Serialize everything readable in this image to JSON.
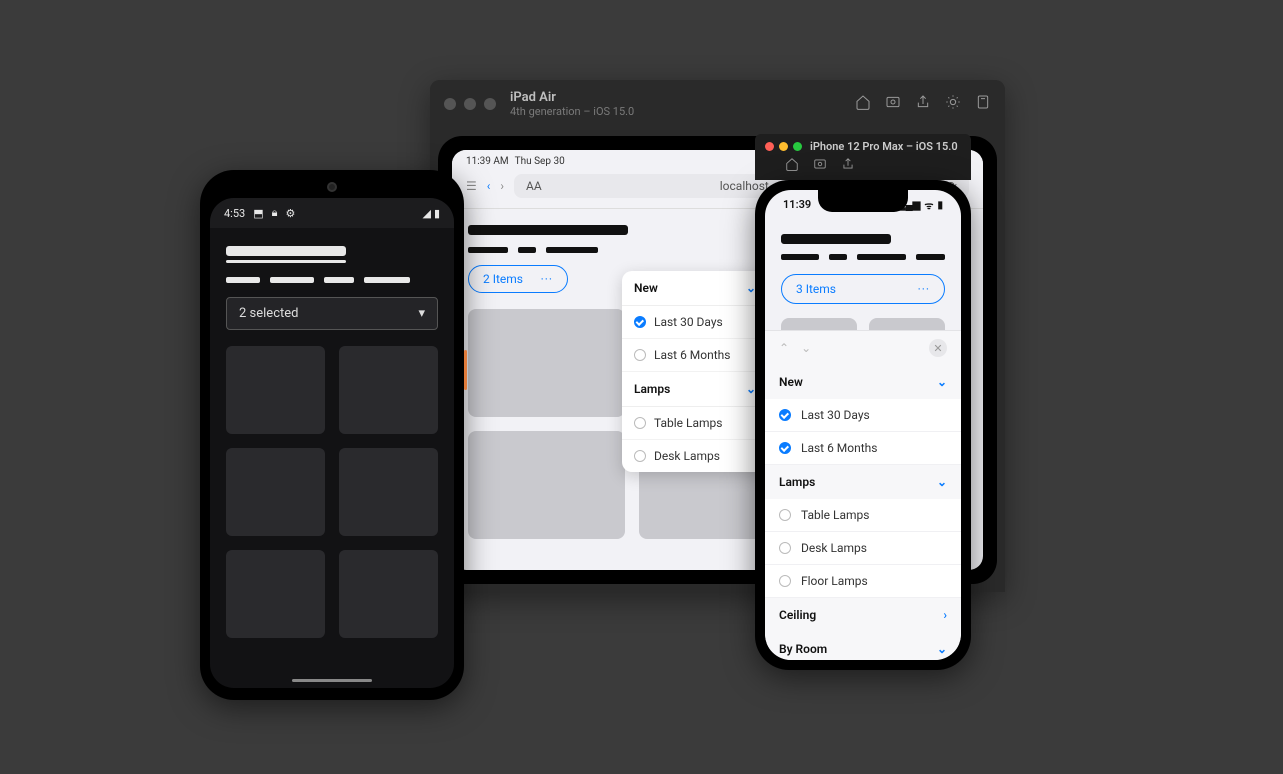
{
  "ipad": {
    "titlebar": {
      "name": "iPad Air",
      "detail": "4th generation – iOS 15.0"
    },
    "status": {
      "time": "11:39 AM",
      "date": "Thu Sep 30"
    },
    "address": {
      "aa": "AA",
      "host": "localhost"
    },
    "filter_pill": {
      "label": "2 Items",
      "menu": "···"
    },
    "popover": {
      "sections": [
        {
          "title": "New",
          "items": [
            {
              "label": "Last 30 Days",
              "checked": true
            },
            {
              "label": "Last 6 Months",
              "checked": false
            }
          ]
        },
        {
          "title": "Lamps",
          "items": [
            {
              "label": "Table Lamps",
              "checked": false
            },
            {
              "label": "Desk Lamps",
              "checked": false
            }
          ]
        }
      ]
    }
  },
  "iphone": {
    "titlebar": {
      "name": "iPhone 12 Pro Max – iOS 15.0"
    },
    "status": {
      "time": "11:39"
    },
    "filter_pill": {
      "label": "3 Items",
      "menu": "···"
    },
    "sheet": {
      "sections": [
        {
          "title": "New",
          "expanded": true,
          "items": [
            {
              "label": "Last 30 Days",
              "checked": true
            },
            {
              "label": "Last 6 Months",
              "checked": true
            }
          ]
        },
        {
          "title": "Lamps",
          "expanded": true,
          "items": [
            {
              "label": "Table Lamps",
              "checked": false
            },
            {
              "label": "Desk Lamps",
              "checked": false
            },
            {
              "label": "Floor Lamps",
              "checked": false
            }
          ]
        },
        {
          "title": "Ceiling",
          "expanded": false,
          "items": []
        },
        {
          "title": "By Room",
          "expanded": true,
          "items": []
        }
      ]
    }
  },
  "android": {
    "status": {
      "time": "4:53"
    },
    "select": {
      "label": "2 selected"
    }
  }
}
